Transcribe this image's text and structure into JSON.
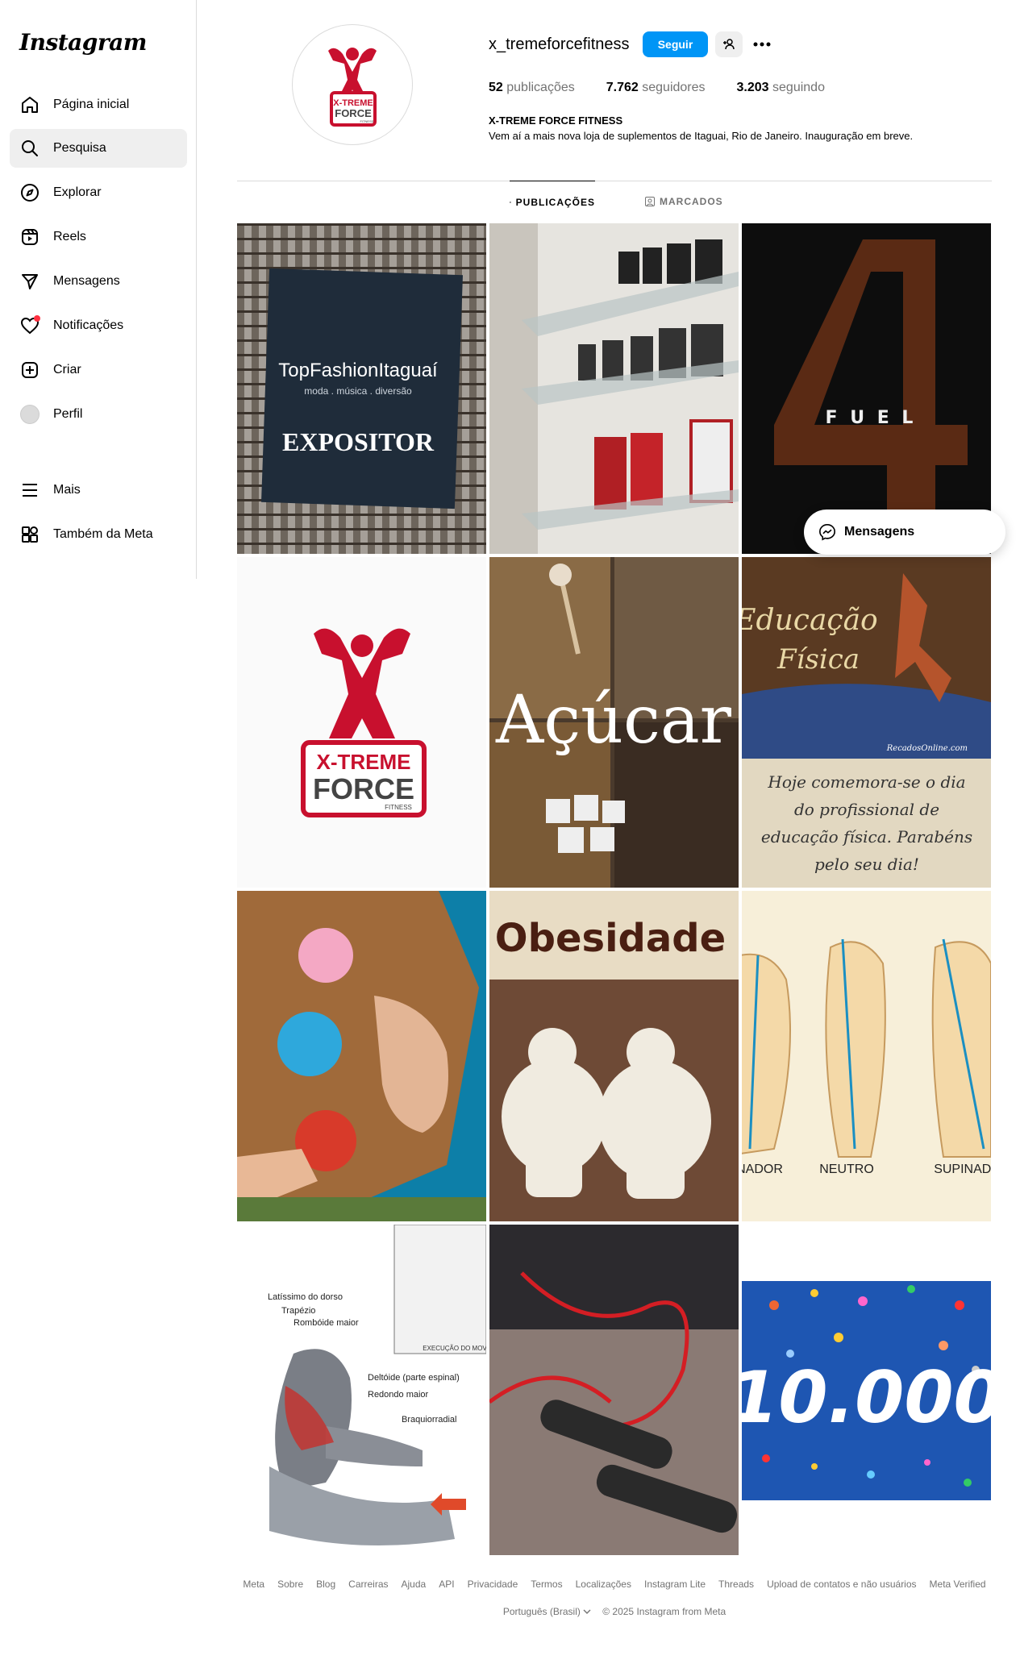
{
  "app": {
    "logo": "Instagram"
  },
  "sidebar": {
    "items": [
      {
        "label": "Página inicial",
        "icon": "home-icon"
      },
      {
        "label": "Pesquisa",
        "icon": "search-icon"
      },
      {
        "label": "Explorar",
        "icon": "compass-icon"
      },
      {
        "label": "Reels",
        "icon": "reels-icon"
      },
      {
        "label": "Mensagens",
        "icon": "messages-icon"
      },
      {
        "label": "Notificações",
        "icon": "heart-icon"
      },
      {
        "label": "Criar",
        "icon": "create-icon"
      },
      {
        "label": "Perfil",
        "icon": "avatar"
      },
      {
        "label": "Mais",
        "icon": "menu-icon"
      },
      {
        "label": "Também da Meta",
        "icon": "meta-apps-icon"
      }
    ]
  },
  "profile": {
    "username": "x_tremeforcefitness",
    "follow_label": "Seguir",
    "stats": {
      "posts_count": "52",
      "posts_label": "publicações",
      "followers_count": "7.762",
      "followers_label": "seguidores",
      "following_count": "3.203",
      "following_label": "seguindo"
    },
    "full_name": "X-TREME FORCE FITNESS",
    "bio": "Vem aí a mais nova loja de suplementos de Itaguai, Rio de Janeiro. Inauguração em breve.",
    "logo_text": {
      "line1": "X-TREME",
      "line2": "FORCE",
      "line3": "FITNESS"
    }
  },
  "tabs": [
    {
      "label": "PUBLICAÇÕES",
      "icon": "grid-icon"
    },
    {
      "label": "MARCADOS",
      "icon": "tagged-icon"
    }
  ],
  "posts": {
    "p1": {
      "brand": "TopFashionItaguaí",
      "sub": "moda . música . diversão",
      "title": "EXPOSITOR"
    },
    "p3": {
      "text": "F U E L"
    },
    "p4": {
      "line1": "X-TREME",
      "line2": "FORCE",
      "line3": "FITNESS"
    },
    "p5": {
      "text": "Açúcar"
    },
    "p6": {
      "title1": "Educação",
      "title2": "Física",
      "credit": "RecadosOnline.com",
      "caption": "Hoje comemora-se o dia do profissional de educação física. Parabéns pelo seu dia!"
    },
    "p8": {
      "title": "Obesidade"
    },
    "p9": {
      "left": "NADOR",
      "center": "NEUTRO",
      "right": "SUPINADO"
    },
    "p10": {
      "l1": "Latíssimo do dorso",
      "l2": "Trapézio",
      "l3": "Rombóide maior",
      "l4": "Deltóide (parte espinal)",
      "l5": "Redondo maior",
      "l6": "Braquiorradial",
      "l7": "EXECUÇÃO DO MOV"
    },
    "p12": {
      "text": "10.000"
    }
  },
  "floating": {
    "messages_label": "Mensagens"
  },
  "footer": {
    "links": [
      "Meta",
      "Sobre",
      "Blog",
      "Carreiras",
      "Ajuda",
      "API",
      "Privacidade",
      "Termos",
      "Localizações",
      "Instagram Lite",
      "Threads",
      "Upload de contatos e não usuários",
      "Meta Verified"
    ],
    "language": "Português (Brasil)",
    "copyright": "© 2025 Instagram from Meta"
  },
  "colors": {
    "accent": "#0095f6",
    "brand_red": "#c8102e",
    "text_secondary": "#737373",
    "border": "#dbdbdb"
  }
}
